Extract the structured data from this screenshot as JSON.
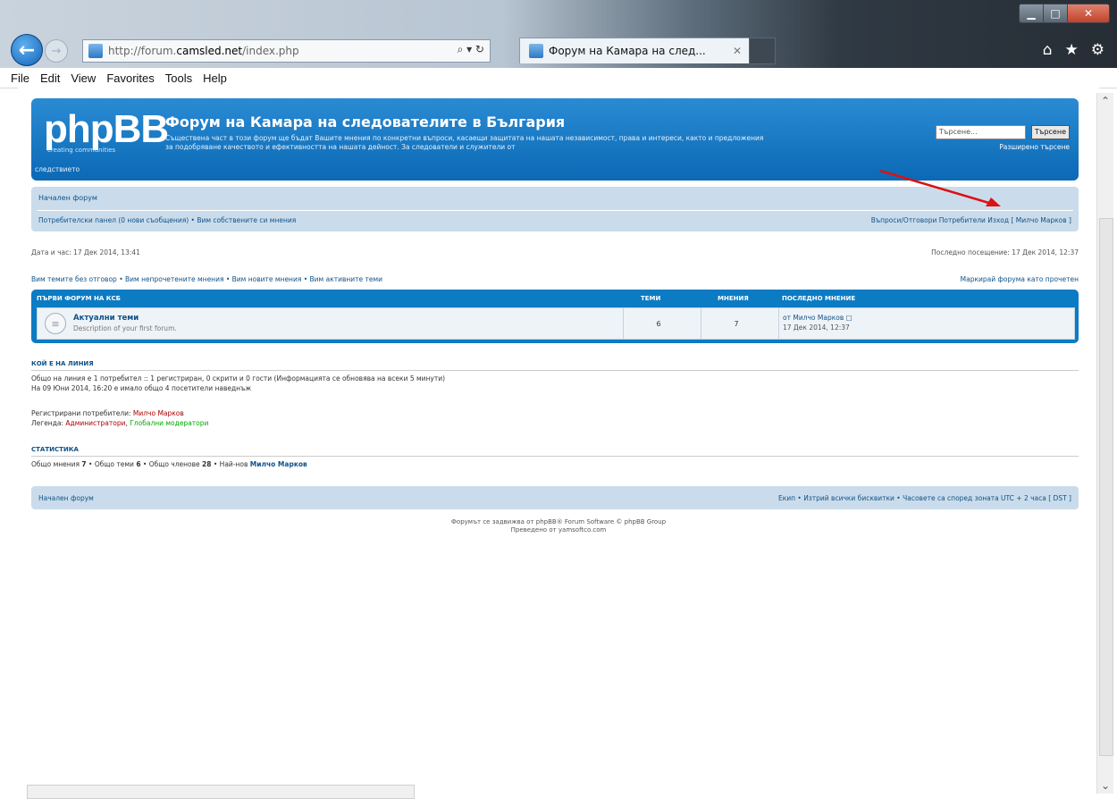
{
  "browser": {
    "address_prefix": "http://forum.",
    "address_domain": "camsled.net",
    "address_suffix": "/index.php",
    "address_tools": "⌕ ▾ ↻",
    "tab_title": "Форум на Камара на след...",
    "tab_close": "✕",
    "back_glyph": "←",
    "forward_glyph": "→",
    "right_icons": [
      "⌂",
      "★",
      "⚙"
    ],
    "window_buttons": {
      "minimize": "▁",
      "maximize": "□",
      "close": "✕"
    }
  },
  "menu": [
    "File",
    "Edit",
    "View",
    "Favorites",
    "Tools",
    "Help"
  ],
  "header": {
    "logo": "phpBB",
    "logo_tagline": "creating communities",
    "site_name": "Форум на Камара на следователите в България",
    "description": "Съществена част в този форум ще бъдат Вашите мнения по конкретни въпроси, касаещи защитата на нашата независимост, права и интереси, както и предложения за подобряване качеството и ефективността на нашата дейност. За следователи и служители от",
    "description_end": "следствието",
    "search_placeholder": "Търсене...",
    "search_button": "Търсене",
    "advanced_search": "Разширено търсене"
  },
  "nav": {
    "index_link": "Начален форум",
    "ucp": "Потребителски панел (0 нови съобщения) • Вим собствените си мнения",
    "right_links": "Въпроси/Отговори  Потребители  Изход [ Милчо Марков ]"
  },
  "info": {
    "datetime": "Дата и час: 17 Дек 2014, 13:41",
    "last_visit": "Последно посещение: 17 Дек 2014, 12:37",
    "links": "Вим темите без отговор • Вим непрочетените мнения • Вим новите мнения • Вим активните теми",
    "mark_read": "Маркирай форума като прочетен"
  },
  "forum_table": {
    "headers": [
      "ПЪРВИ ФОРУМ НА КСБ",
      "ТЕМИ",
      "МНЕНИЯ",
      "ПОСЛЕДНО МНЕНИЕ"
    ],
    "rows": [
      {
        "icon": "≡",
        "name": "Актуални теми",
        "description": "Description of your first forum.",
        "topics": "6",
        "posts": "7",
        "last_post_by": "от Милчо Марков □",
        "last_post_time": "17 Дек 2014, 12:37"
      }
    ]
  },
  "online": {
    "heading": "КОЙ Е НА ЛИНИЯ",
    "line1": "Общо на линия е 1 потребител :: 1 регистриран, 0 скрити и 0 гости (Информацията се обновява на всеки 5 минути)",
    "line2": "На 09 Юни 2014, 16:20 е имало общо 4 посетители наведнъж",
    "registered_label": "Регистрирани потребители: ",
    "registered_user": "Милчо Марков",
    "legend_label": "Легенда: ",
    "legend_admin": "Администратори",
    "legend_sep": ", ",
    "legend_mod": "Глобални модератори"
  },
  "stats": {
    "heading": "СТАТИСТИКА",
    "text_a": "Общо мнения ",
    "posts": "7",
    "text_b": " • Общо теми ",
    "topics": "6",
    "text_c": " • Общо членове ",
    "members": "28",
    "text_d": " • Най-нов ",
    "newest": "Милчо Марков"
  },
  "footer": {
    "index_link": "Начален форум",
    "right": "Екип • Изтрий всички бисквитки • Часовете са според зоната UTC + 2 часа [ DST ]",
    "powered": "Форумът се задвижва от phpBB® Forum Software © phpBB Group",
    "translated": "Преведено от yamsoftco.com"
  }
}
